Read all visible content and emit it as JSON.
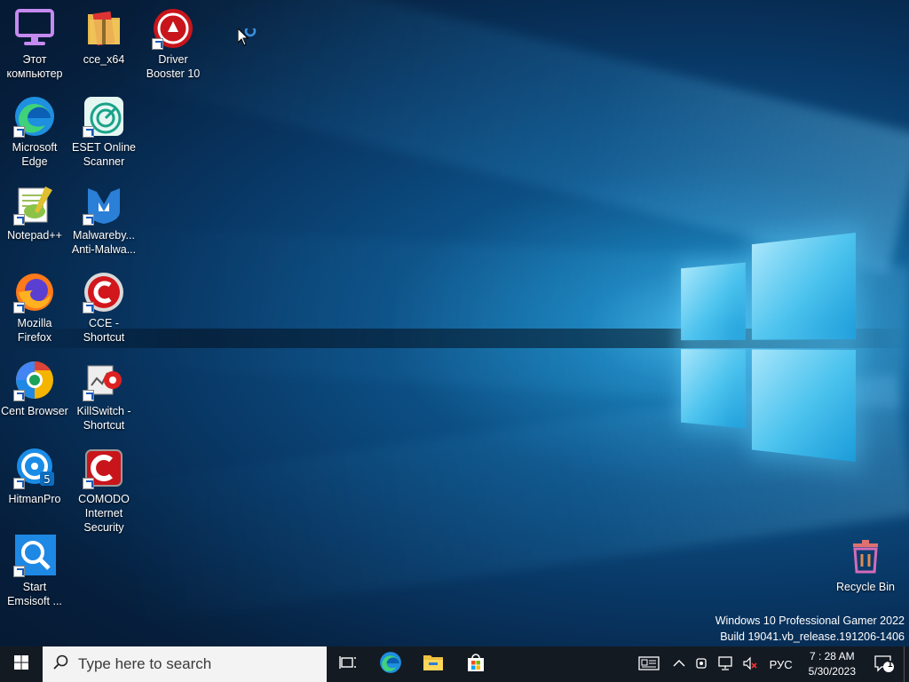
{
  "desktop": {
    "icons": [
      {
        "label": "Этот\nкомпьютер",
        "icon": "computer-icon",
        "shortcut": false
      },
      {
        "label": "cce_x64",
        "icon": "archive-folder-icon",
        "shortcut": false
      },
      {
        "label": "Driver\nBooster 10",
        "icon": "driver-booster-icon",
        "shortcut": true
      },
      {
        "label": "Microsoft\nEdge",
        "icon": "edge-icon",
        "shortcut": true
      },
      {
        "label": "ESET Online\nScanner",
        "icon": "eset-icon",
        "shortcut": true
      },
      {
        "label": "Notepad++",
        "icon": "notepadpp-icon",
        "shortcut": true
      },
      {
        "label": "Malwareby...\nAnti-Malwa...",
        "icon": "malwarebytes-icon",
        "shortcut": true
      },
      {
        "label": "Mozilla\nFirefox",
        "icon": "firefox-icon",
        "shortcut": true
      },
      {
        "label": "CCE -\nShortcut",
        "icon": "cce-icon",
        "shortcut": true
      },
      {
        "label": "Cent Browser",
        "icon": "cent-browser-icon",
        "shortcut": true
      },
      {
        "label": "KillSwitch -\nShortcut",
        "icon": "killswitch-icon",
        "shortcut": true
      },
      {
        "label": "HitmanPro",
        "icon": "hitmanpro-icon",
        "shortcut": true
      },
      {
        "label": "COMODO\nInternet\nSecurity",
        "icon": "comodo-icon",
        "shortcut": true
      },
      {
        "label": "Start\nEmsisoft ...",
        "icon": "emsisoft-icon",
        "shortcut": true
      },
      {
        "label": "Recycle Bin",
        "icon": "recycle-bin-icon",
        "shortcut": false
      }
    ],
    "watermark_line1": "Windows 10 Professional Gamer 2022",
    "watermark_line2": "Build 19041.vb_release.191206-1406"
  },
  "taskbar": {
    "search_placeholder": "Type here to search",
    "language": "РУС",
    "time": "7 : 28 AM",
    "date": "5/30/2023",
    "notification_count": "1"
  }
}
